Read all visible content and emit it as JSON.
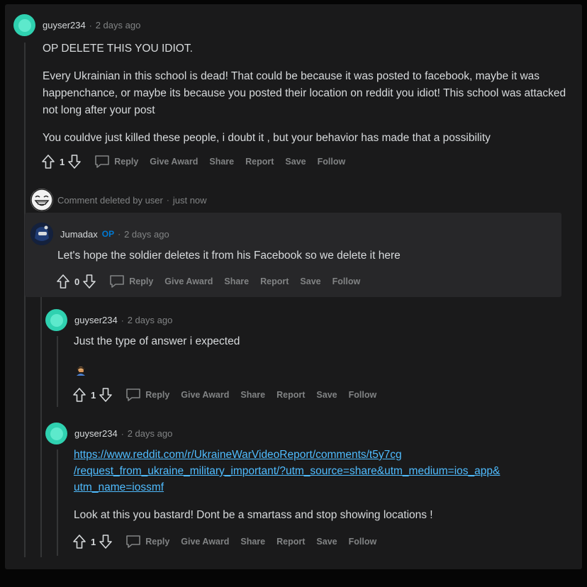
{
  "comments": [
    {
      "username": "guyser234",
      "time": "2 days ago",
      "paragraphs": [
        "OP DELETE THIS YOU IDIOT.",
        "Every Ukrainian in this school is dead! That could be because it was posted to facebook, maybe it was happenchance, or maybe its because you posted their location on reddit you idiot! This school was attacked not long after your post",
        "You couldve just killed these people, i doubt it , but your behavior has made that a possibility"
      ],
      "score": "1"
    },
    {
      "deleted_label": "Comment deleted by user",
      "time": "just now"
    },
    {
      "username": "Jumadax",
      "op_badge": "OP",
      "time": "2 days ago",
      "paragraphs": [
        "Let's hope the soldier deletes it from his Facebook so we delete it here"
      ],
      "score": "0"
    },
    {
      "username": "guyser234",
      "time": "2 days ago",
      "paragraphs": [
        "Just the type of answer i expected"
      ],
      "score": "1"
    },
    {
      "username": "guyser234",
      "time": "2 days ago",
      "link_lines": [
        "https://www.reddit.com/r/UkraineWarVideoReport/comments/t5y7cg",
        "/request_from_ukraine_military_important/?utm_source=share&utm_medium=ios_app&",
        "utm_name=iossmf"
      ],
      "paragraphs": [
        "Look at this you bastard! Dont be a smartass and stop showing locations !"
      ],
      "score": "1"
    }
  ],
  "actions": {
    "reply": "Reply",
    "give_award": "Give Award",
    "share": "Share",
    "report": "Report",
    "save": "Save",
    "follow": "Follow"
  },
  "dot": "·",
  "colors": {
    "background": "#1a1a1b",
    "text": "#d7dadc",
    "meta": "#818384",
    "link": "#4fbcff",
    "op_badge": "#0079d3",
    "avatar": "#2fd1b0"
  }
}
